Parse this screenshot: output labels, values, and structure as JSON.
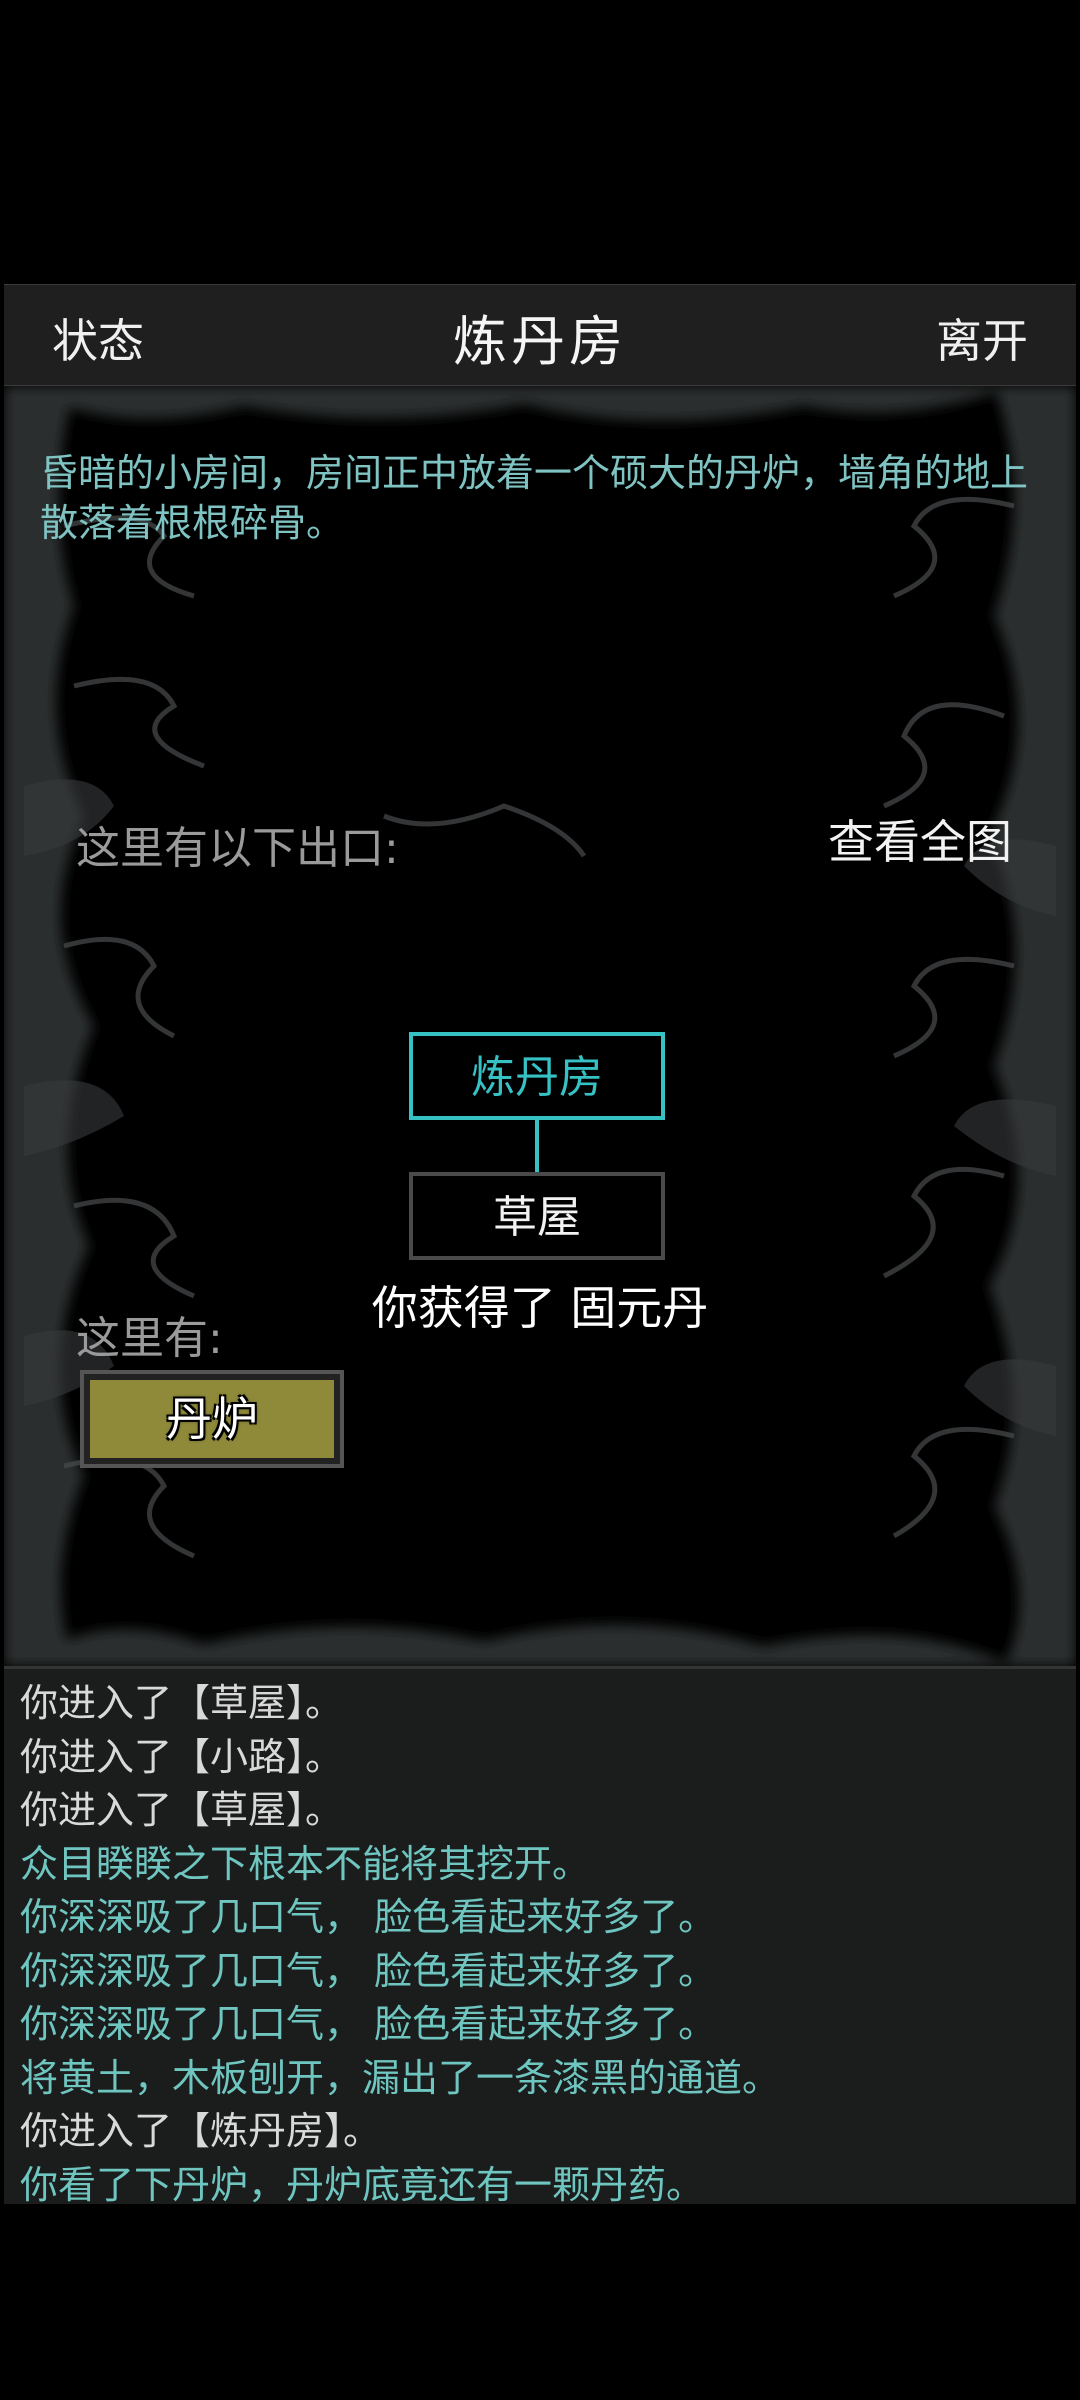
{
  "header": {
    "status_label": "状态",
    "title": "炼丹房",
    "leave_label": "离开"
  },
  "scene": {
    "description": "昏暗的小房间，房间正中放着一个硕大的丹炉，墙角的地上散落着根根碎骨。",
    "exits_label": "这里有以下出口:",
    "full_map_label": "查看全图",
    "map": {
      "current_room": "炼丹房",
      "exit_room": "草屋"
    },
    "toast": "你获得了 固元丹",
    "here_label": "这里有:",
    "items": [
      {
        "label": "丹炉"
      }
    ]
  },
  "log": {
    "lines": [
      {
        "text": "你进入了【草屋】。",
        "color": "white"
      },
      {
        "text": "你进入了【小路】。",
        "color": "white"
      },
      {
        "text": "你进入了【草屋】。",
        "color": "white"
      },
      {
        "text": "众目睽睽之下根本不能将其挖开。",
        "color": "teal"
      },
      {
        "text": "你深深吸了几口气，  脸色看起来好多了。",
        "color": "teal"
      },
      {
        "text": "你深深吸了几口气，  脸色看起来好多了。",
        "color": "teal"
      },
      {
        "text": "你深深吸了几口气，  脸色看起来好多了。",
        "color": "teal"
      },
      {
        "text": "将黄土，木板刨开，漏出了一条漆黑的通道。",
        "color": "teal"
      },
      {
        "text": "你进入了【炼丹房】。",
        "color": "white"
      },
      {
        "text": "你看了下丹炉，丹炉底竟还有一颗丹药。",
        "color": "teal"
      }
    ]
  },
  "colors": {
    "accent_teal": "#36c1c4",
    "description_text": "#7fc3c3",
    "item_button": "#8f8a3a",
    "log_background": "#1b1c1c"
  }
}
